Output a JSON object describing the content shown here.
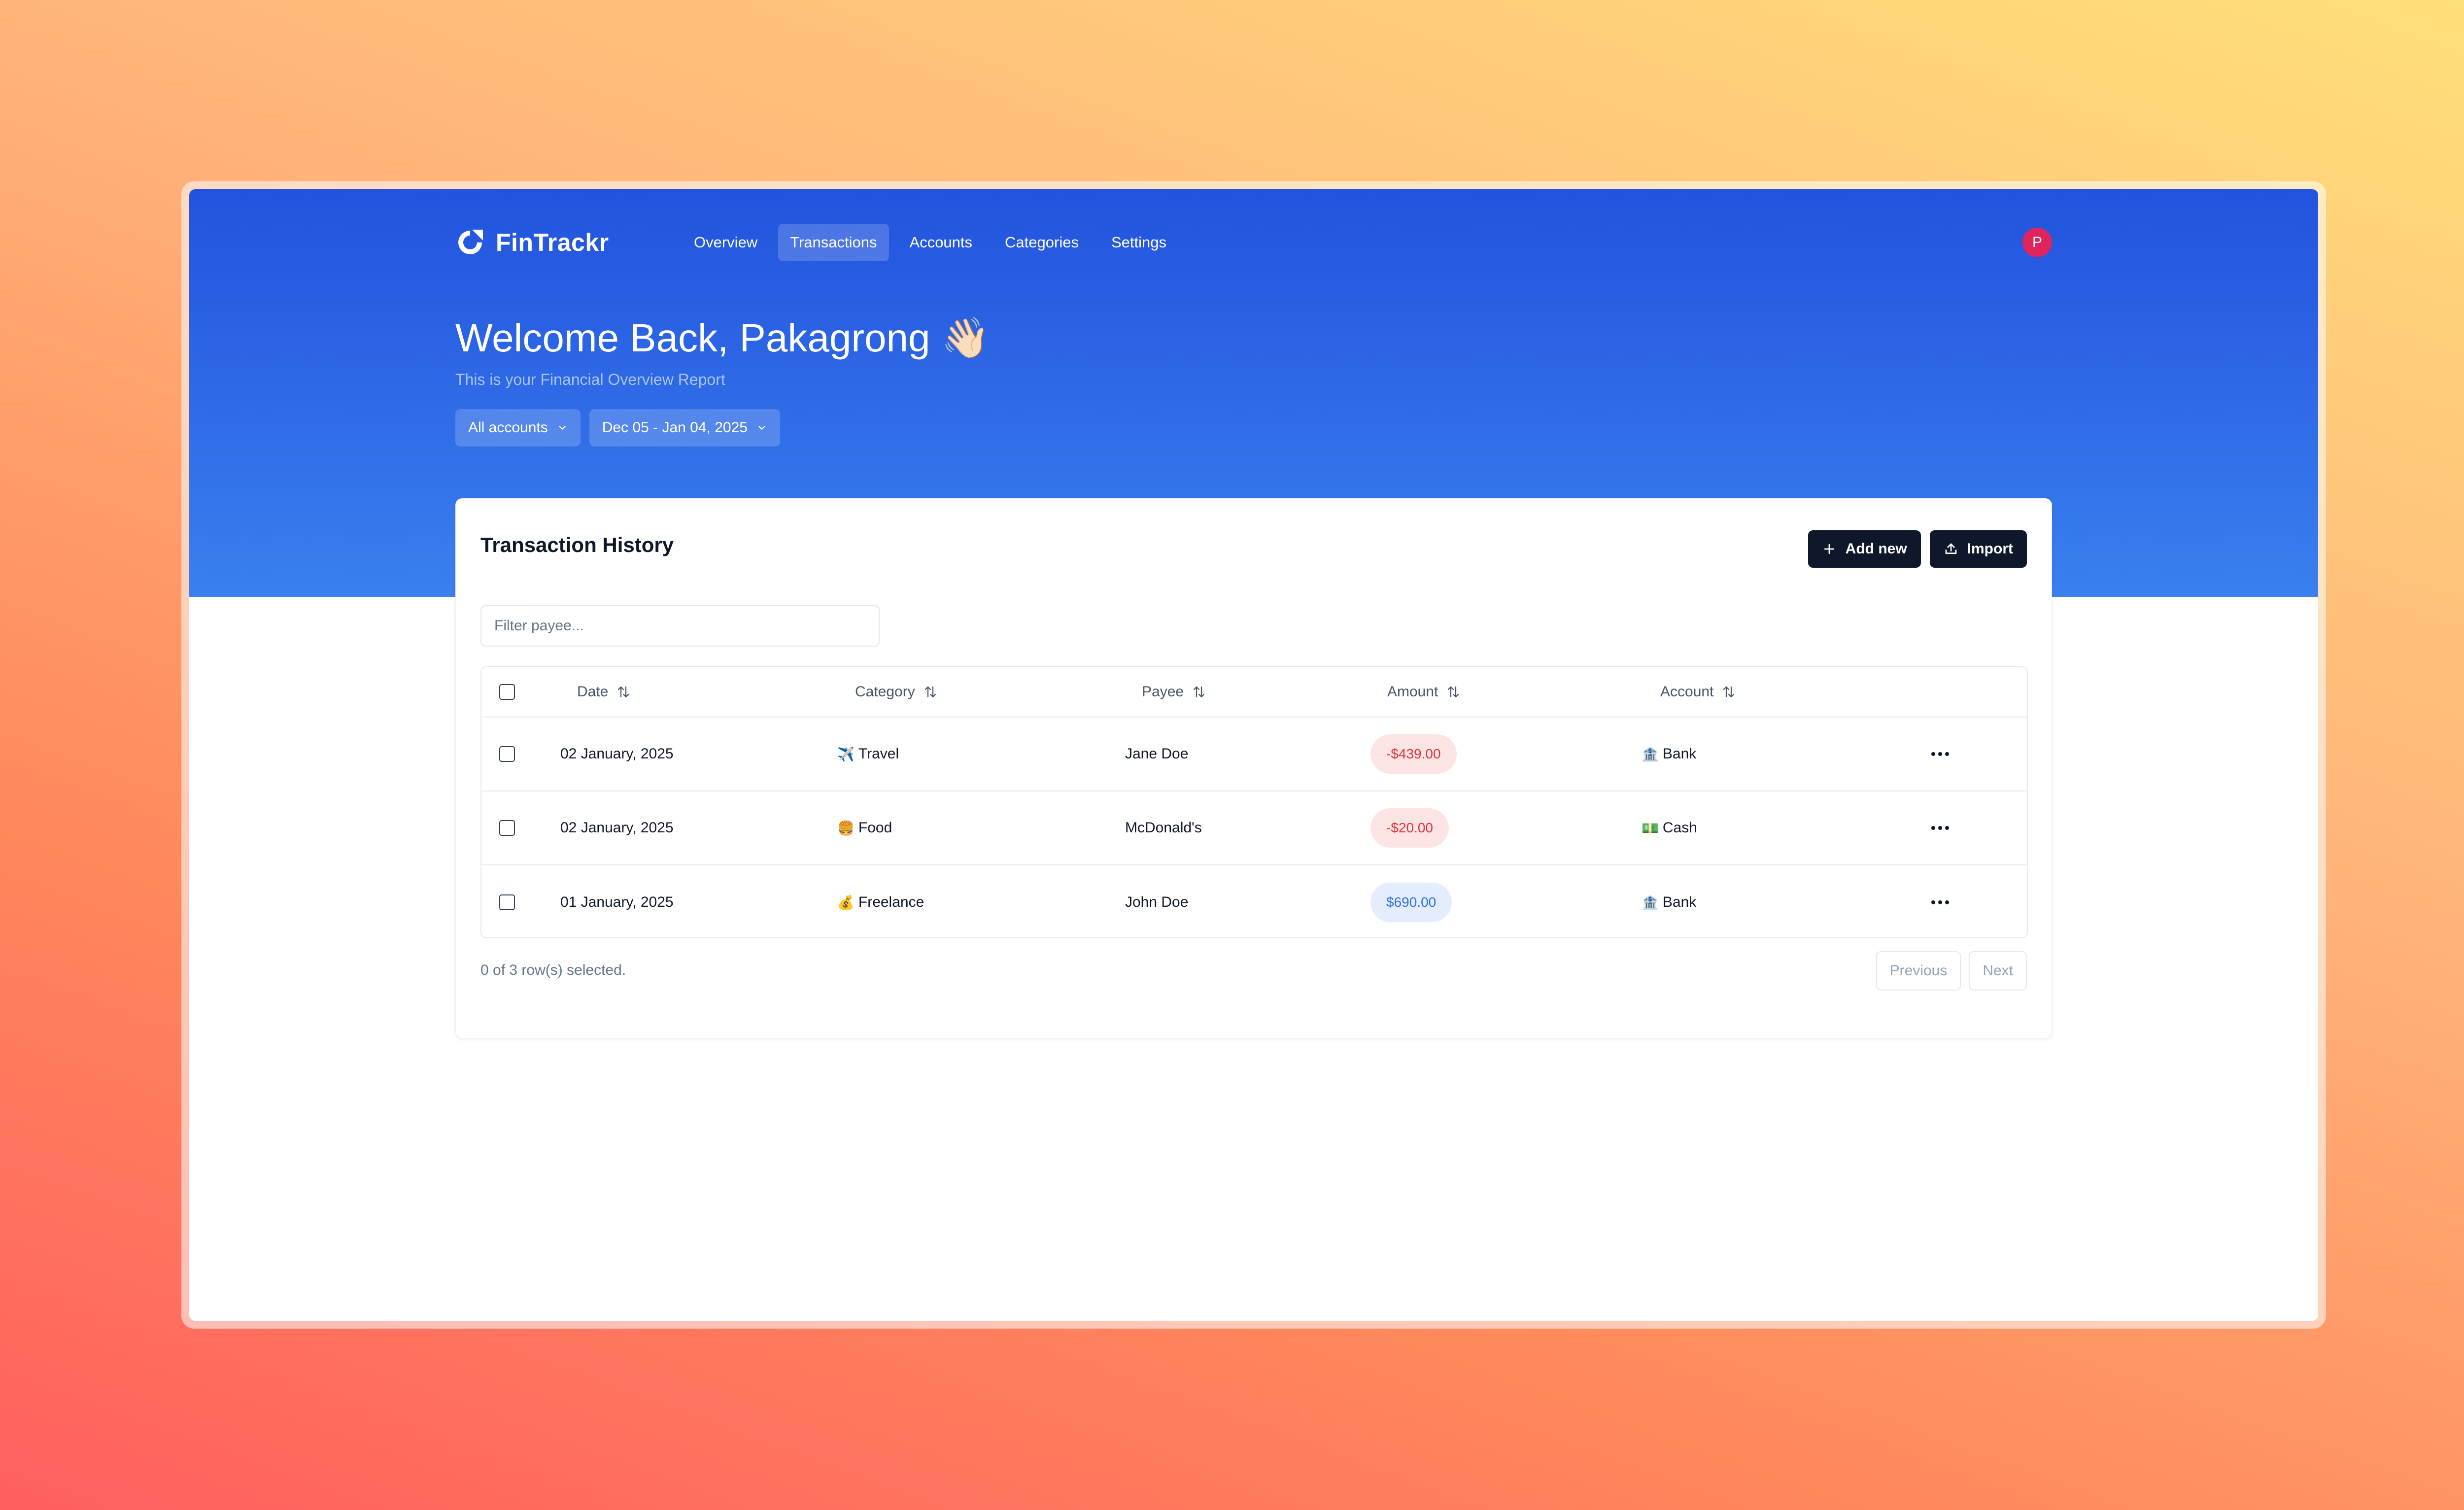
{
  "app": {
    "name": "FinTrackr",
    "avatar_initial": "P"
  },
  "nav": {
    "items": [
      {
        "label": "Overview",
        "active": false
      },
      {
        "label": "Transactions",
        "active": true
      },
      {
        "label": "Accounts",
        "active": false
      },
      {
        "label": "Categories",
        "active": false
      },
      {
        "label": "Settings",
        "active": false
      }
    ]
  },
  "hero": {
    "welcome": "Welcome Back, Pakagrong 👋🏻",
    "subtitle": "This is your Financial Overview Report",
    "account_filter": "All accounts",
    "date_filter": "Dec 05 - Jan 04, 2025"
  },
  "card": {
    "title": "Transaction History",
    "add_label": "Add new",
    "import_label": "Import",
    "filter_placeholder": "Filter payee...",
    "columns": [
      "Date",
      "Category",
      "Payee",
      "Amount",
      "Account"
    ],
    "rows": [
      {
        "date": "02 January, 2025",
        "category_icon": "✈️",
        "category": "Travel",
        "payee": "Jane Doe",
        "amount": "-$439.00",
        "amount_type": "negative",
        "account_icon": "🏦",
        "account": "Bank"
      },
      {
        "date": "02 January, 2025",
        "category_icon": "🍔",
        "category": "Food",
        "payee": "McDonald's",
        "amount": "-$20.00",
        "amount_type": "negative",
        "account_icon": "💵",
        "account": "Cash"
      },
      {
        "date": "01 January, 2025",
        "category_icon": "💰",
        "category": "Freelance",
        "payee": "John Doe",
        "amount": "$690.00",
        "amount_type": "positive",
        "account_icon": "🏦",
        "account": "Bank"
      }
    ],
    "selection_status": "0 of 3 row(s) selected.",
    "prev_label": "Previous",
    "next_label": "Next"
  },
  "colors": {
    "hero_top": "#2253dd",
    "hero_bottom": "#3a80ef",
    "negative_bg": "#fde4e4",
    "negative_text": "#e0353d",
    "positive_bg": "#e3edfc",
    "positive_text": "#2f6fe0",
    "dark_button": "#0f172a",
    "avatar": "#e0245e"
  }
}
